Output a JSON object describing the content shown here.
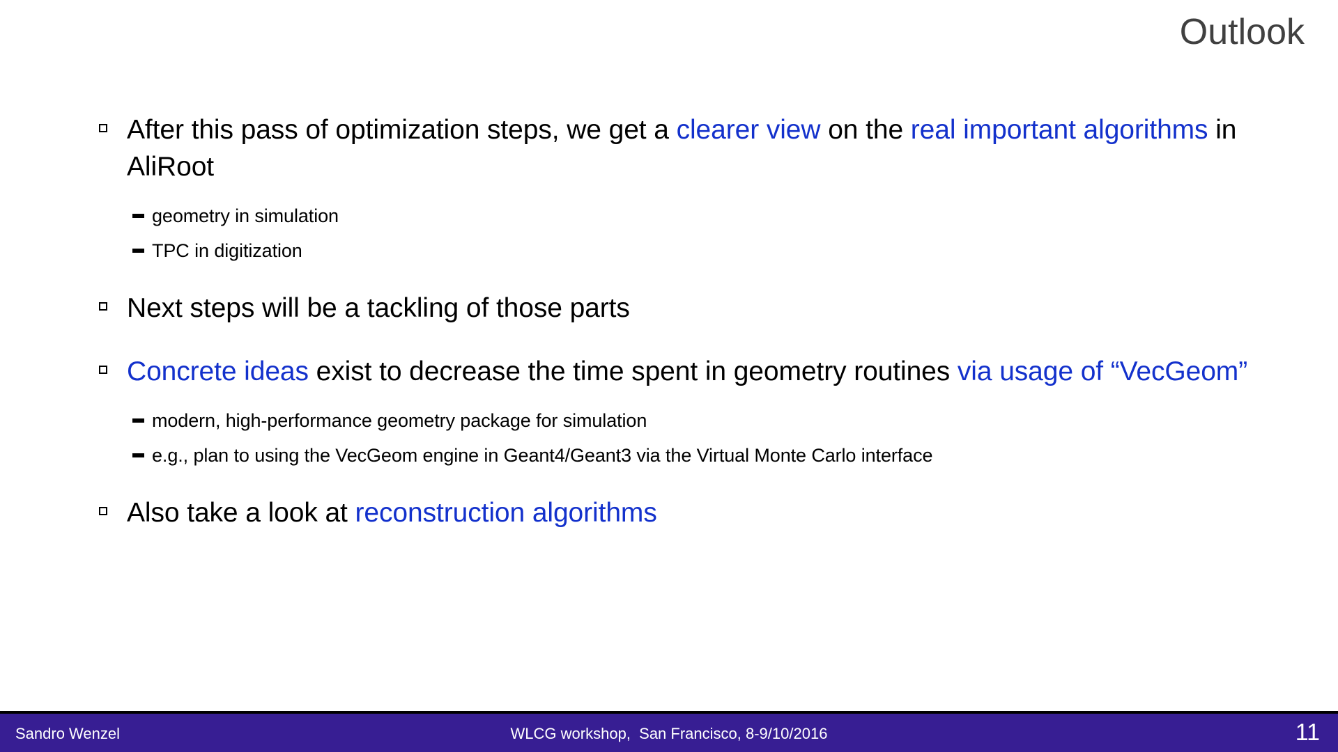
{
  "slide": {
    "title": "Outlook",
    "title_color": "#404040",
    "accent_blue": "#1331cc",
    "footer_bar_color": "#371e93",
    "background": "#ffffff"
  },
  "bullets": {
    "b1": {
      "marker": "hollow-square",
      "seg1": "After this pass of optimization steps, we get a ",
      "seg2_blue": "clearer view",
      "seg3": " on the ",
      "seg4_blue": "real important algorithms",
      "seg5": " in AliRoot"
    },
    "b1_subs": [
      {
        "marker": "dash",
        "text": "geometry in simulation"
      },
      {
        "marker": "dash",
        "text": "TPC in digitization"
      }
    ],
    "b2": {
      "marker": "hollow-square",
      "text": "Next steps will be a tackling of those parts"
    },
    "b3": {
      "marker": "hollow-square",
      "seg1_blue": "Concrete ideas",
      "seg2": " exist to decrease the time spent in geometry routines ",
      "seg3_blue": "via usage of “VecGeom”"
    },
    "b3_subs": [
      {
        "marker": "dash",
        "text": "modern, high-performance geometry package for simulation"
      },
      {
        "marker": "dash",
        "text": "e.g., plan to using the VecGeom engine in Geant4/Geant3 via the Virtual Monte Carlo interface"
      }
    ],
    "b4": {
      "marker": "hollow-square",
      "seg1": "Also take a look at ",
      "seg2_blue": "reconstruction algorithms"
    }
  },
  "footer": {
    "author": "Sandro Wenzel",
    "center": "WLCG workshop,  San Francisco, 8-9/10/2016",
    "page_number": "11"
  }
}
